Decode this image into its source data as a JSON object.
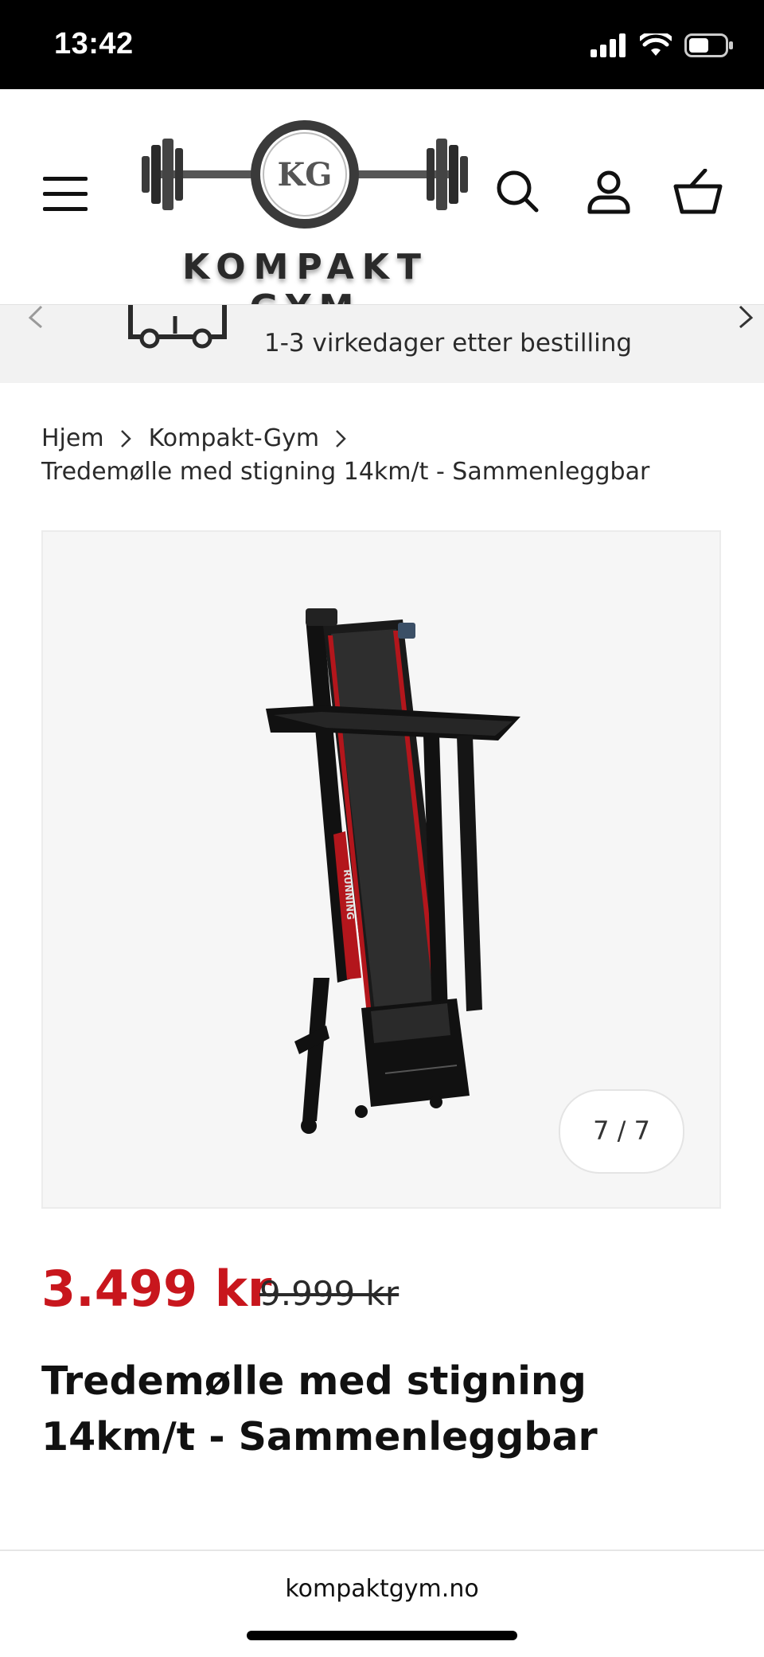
{
  "status_bar": {
    "time": "13:42"
  },
  "header": {
    "brand_initials": "KG",
    "brand_name": "KOMPAKT GYM"
  },
  "announcement": {
    "text": "1-3 virkedager etter bestilling"
  },
  "breadcrumb": {
    "items": [
      "Hjem",
      "Kompakt-Gym"
    ],
    "current": "Tredemølle med stigning 14km/t - Sammenleggbar"
  },
  "gallery": {
    "counter": "7 / 7",
    "decal_text": "RUNNING"
  },
  "product": {
    "price": "3.499 kr",
    "compare_price": "9.999 kr",
    "title": "Tredemølle med stigning 14km/t - Sammenleggbar"
  },
  "browser": {
    "url": "kompaktgym.no"
  },
  "colors": {
    "sale_price": "#c8161d",
    "status_bar": "#000000",
    "announcement_bg": "#f2f2f2"
  }
}
